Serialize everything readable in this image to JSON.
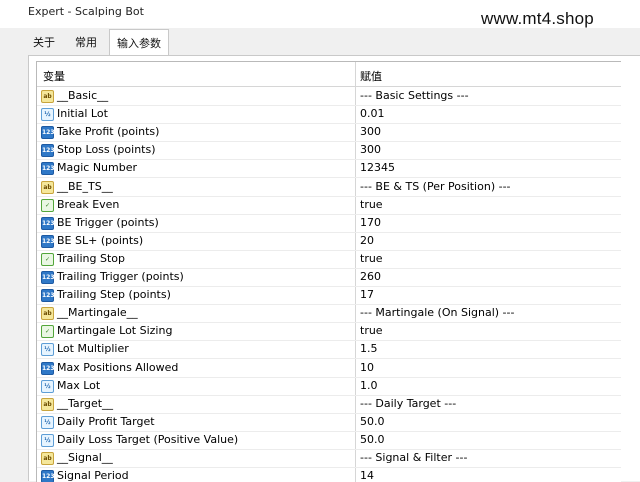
{
  "window": {
    "title": "Expert - Scalping Bot"
  },
  "watermark": "www.mt4.shop",
  "tabs": [
    {
      "label": "关于"
    },
    {
      "label": "常用"
    },
    {
      "label": "输入参数"
    }
  ],
  "table": {
    "headers": {
      "variable": "变量",
      "value": "赋值"
    },
    "rows": [
      {
        "icon": "ab-string-icon",
        "name": "__Basic__",
        "value": "--- Basic Settings ---"
      },
      {
        "icon": "double-icon",
        "name": "Initial Lot",
        "value": "0.01"
      },
      {
        "icon": "integer-icon",
        "name": "Take Profit (points)",
        "value": "300"
      },
      {
        "icon": "integer-icon",
        "name": "Stop Loss (points)",
        "value": "300"
      },
      {
        "icon": "integer-icon",
        "name": "Magic Number",
        "value": "12345"
      },
      {
        "icon": "ab-string-icon",
        "name": "__BE_TS__",
        "value": "--- BE & TS (Per Position) ---"
      },
      {
        "icon": "bool-icon",
        "name": "Break Even",
        "value": "true"
      },
      {
        "icon": "integer-icon",
        "name": "BE Trigger (points)",
        "value": "170"
      },
      {
        "icon": "integer-icon",
        "name": "BE SL+ (points)",
        "value": "20"
      },
      {
        "icon": "bool-icon",
        "name": "Trailing Stop",
        "value": "true"
      },
      {
        "icon": "integer-icon",
        "name": "Trailing Trigger (points)",
        "value": "260"
      },
      {
        "icon": "integer-icon",
        "name": "Trailing Step (points)",
        "value": "17"
      },
      {
        "icon": "ab-string-icon",
        "name": "__Martingale__",
        "value": "--- Martingale (On Signal) ---"
      },
      {
        "icon": "bool-icon",
        "name": "Martingale Lot Sizing",
        "value": "true"
      },
      {
        "icon": "double-icon",
        "name": "Lot Multiplier",
        "value": "1.5"
      },
      {
        "icon": "integer-icon",
        "name": "Max Positions Allowed",
        "value": "10"
      },
      {
        "icon": "double-icon",
        "name": "Max Lot",
        "value": "1.0"
      },
      {
        "icon": "ab-string-icon",
        "name": "__Target__",
        "value": "--- Daily Target ---"
      },
      {
        "icon": "double-icon",
        "name": "Daily Profit Target",
        "value": "50.0"
      },
      {
        "icon": "double-icon",
        "name": "Daily Loss Target (Positive Value)",
        "value": "50.0"
      },
      {
        "icon": "ab-string-icon",
        "name": "__Signal__",
        "value": "--- Signal & Filter ---"
      },
      {
        "icon": "integer-icon",
        "name": "Signal Period",
        "value": "14"
      }
    ]
  },
  "icon_glyphs": {
    "ab-string-icon": "ab",
    "double-icon": "½",
    "integer-icon": "123",
    "bool-icon": "✓"
  }
}
